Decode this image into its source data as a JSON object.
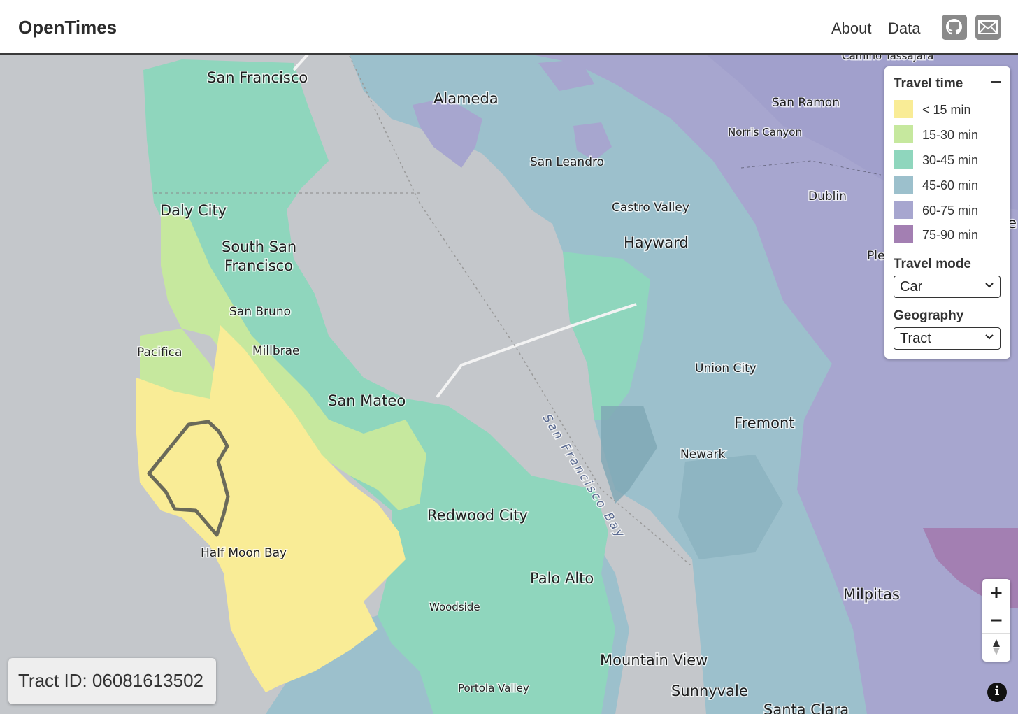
{
  "header": {
    "brand": "OpenTimes",
    "nav": [
      {
        "label": "About"
      },
      {
        "label": "Data"
      }
    ],
    "icons": [
      "github-icon",
      "mail-icon"
    ]
  },
  "legend": {
    "travel_time_title": "Travel time",
    "bins": [
      {
        "label": "< 15 min",
        "color": "#f9ec96"
      },
      {
        "label": "15-30 min",
        "color": "#c6e89e"
      },
      {
        "label": "30-45 min",
        "color": "#8fd6bd"
      },
      {
        "label": "45-60 min",
        "color": "#9cc0cc"
      },
      {
        "label": "60-75 min",
        "color": "#a7a6cf"
      },
      {
        "label": "75-90 min",
        "color": "#a37fb2"
      }
    ],
    "travel_mode_title": "Travel mode",
    "travel_mode_value": "Car",
    "geography_title": "Geography",
    "geography_value": "Tract"
  },
  "map": {
    "places": {
      "san_francisco": "San Francisco",
      "alameda": "Alameda",
      "san_ramon": "San Ramon",
      "norris_canyon": "Norris Canyon",
      "camino_tassajara": "Camino Tassajara",
      "san_leandro": "San Leandro",
      "daly_city": "Daly City",
      "castro_valley": "Castro Valley",
      "dublin": "Dublin",
      "south_sf_1": "South San",
      "south_sf_2": "Francisco",
      "hayward": "Hayward",
      "ple": "Ple",
      "san_bruno": "San Bruno",
      "pacifica": "Pacifica",
      "millbrae": "Millbrae",
      "union_city": "Union City",
      "san_mateo": "San Mateo",
      "fremont": "Fremont",
      "newark": "Newark",
      "redwood_city": "Redwood City",
      "half_moon_bay": "Half Moon Bay",
      "palo_alto": "Palo Alto",
      "milpitas": "Milpitas",
      "woodside": "Woodside",
      "mountain_view": "Mountain View",
      "sunnyvale": "Sunnyvale",
      "portola_valley": "Portola Valley",
      "santa_clara": "Santa Clara",
      "bay": "San Francisco Bay",
      "edge_e": "e"
    }
  },
  "tract_info": "Tract ID: 06081613502"
}
